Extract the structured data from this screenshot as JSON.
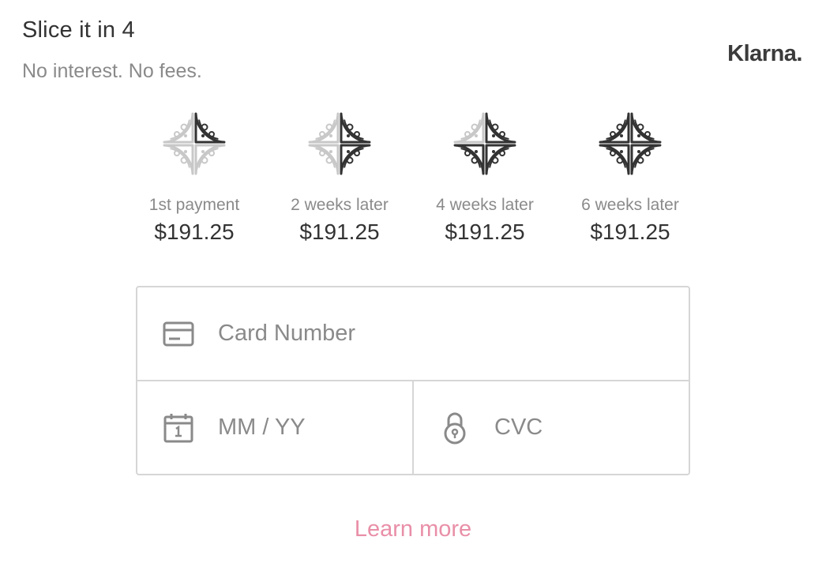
{
  "header": {
    "title": "Slice it in 4",
    "subtitle": "No interest. No fees.",
    "brand": "Klarna."
  },
  "installments": [
    {
      "label": "1st payment",
      "amount": "$191.25",
      "slices_filled": 1
    },
    {
      "label": "2 weeks later",
      "amount": "$191.25",
      "slices_filled": 2
    },
    {
      "label": "4 weeks later",
      "amount": "$191.25",
      "slices_filled": 3
    },
    {
      "label": "6 weeks later",
      "amount": "$191.25",
      "slices_filled": 4
    }
  ],
  "card_form": {
    "card_number": {
      "placeholder": "Card Number",
      "value": "",
      "icon": "credit-card-icon"
    },
    "expiry": {
      "placeholder": "MM / YY",
      "value": "",
      "icon": "calendar-icon"
    },
    "cvc": {
      "placeholder": "CVC",
      "value": "",
      "icon": "lock-icon"
    }
  },
  "footer": {
    "learn_more": "Learn more"
  },
  "colors": {
    "text_primary": "#333333",
    "text_secondary": "#8a8a8a",
    "border": "#d6d6d6",
    "link": "#e98fa8",
    "slice_filled": "#333333",
    "slice_empty": "#c8c8c8"
  }
}
